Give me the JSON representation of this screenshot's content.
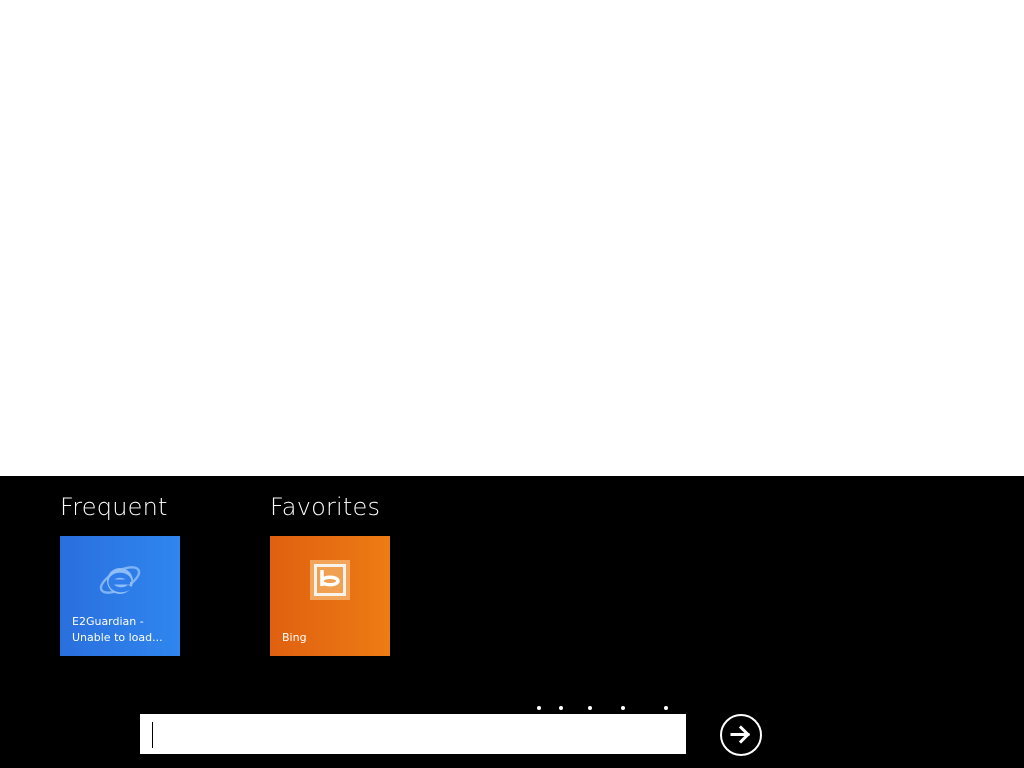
{
  "page": {
    "colors": {
      "content_bg": "#ffffff",
      "bar_bg": "#000000",
      "ie_tile": "#2f7ceb",
      "bing_tile": "#e86e12"
    }
  },
  "frequent": {
    "title": "Frequent",
    "tiles": [
      {
        "label_line1": "E2Guardian -",
        "label_line2": "Unable to load...",
        "icon": "internet-explorer-icon"
      }
    ]
  },
  "favorites": {
    "title": "Favorites",
    "tiles": [
      {
        "label": "Bing",
        "icon": "bing-icon"
      }
    ]
  },
  "address_bar": {
    "value": "",
    "placeholder": ""
  },
  "go_button": {
    "icon": "arrow-right-icon"
  }
}
